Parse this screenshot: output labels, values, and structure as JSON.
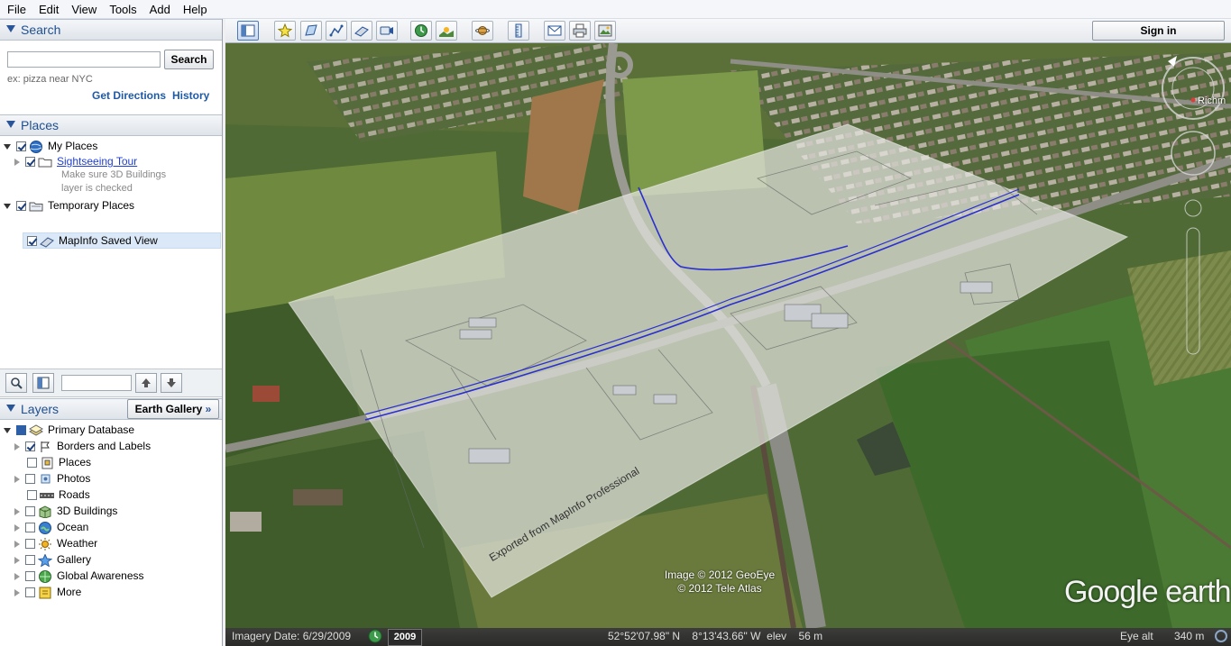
{
  "menu": [
    "File",
    "Edit",
    "View",
    "Tools",
    "Add",
    "Help"
  ],
  "search": {
    "title": "Search",
    "input_value": "",
    "button": "Search",
    "hint": "ex: pizza near NYC",
    "get_directions": "Get Directions",
    "history": "History"
  },
  "places": {
    "title": "Places",
    "my_places": "My Places",
    "sightseeing_tour": "Sightseeing Tour",
    "note_line1": "Make sure 3D Buildings",
    "note_line2": "layer is checked",
    "temporary_places": "Temporary Places",
    "saved_view": "MapInfo Saved View"
  },
  "layers": {
    "title": "Layers",
    "earth_gallery": "Earth Gallery",
    "items": [
      {
        "label": "Primary Database",
        "checked": true
      },
      {
        "label": "Borders and Labels",
        "checked": true
      },
      {
        "label": "Places",
        "checked": false
      },
      {
        "label": "Photos",
        "checked": false
      },
      {
        "label": "Roads",
        "checked": false
      },
      {
        "label": "3D Buildings",
        "checked": false
      },
      {
        "label": "Ocean",
        "checked": false
      },
      {
        "label": "Weather",
        "checked": false
      },
      {
        "label": "Gallery",
        "checked": false
      },
      {
        "label": "Global Awareness",
        "checked": false
      },
      {
        "label": "More",
        "checked": false
      }
    ]
  },
  "toolbar": {
    "sign_in": "Sign in",
    "icons": [
      "sidebar-toggle-icon",
      "placemark-icon",
      "polygon-icon",
      "path-icon",
      "image-overlay-icon",
      "tour-record-icon",
      "historical-imagery-icon",
      "sunlight-icon",
      "planets-icon",
      "ruler-icon",
      "email-icon",
      "print-icon",
      "save-image-icon"
    ]
  },
  "map": {
    "overlay_text": "Exported from MapInfo Professional",
    "compass_label": "Richm",
    "attribution_line1": "Image © 2012 GeoEye",
    "attribution_line2": "© 2012 Tele Atlas",
    "logo_google": "Google",
    "logo_earth": "earth"
  },
  "status": {
    "imagery_date": "Imagery Date: 6/29/2009",
    "year": "2009",
    "coordinates": "52°52'07.98\" N    8°13'43.66\" W  elev    56 m",
    "eye_alt_label": "Eye alt",
    "eye_alt_value": "340 m"
  },
  "colors": {
    "accent": "#1f4f8f",
    "link": "#1f5aa6",
    "route_line": "#2b2fd1"
  }
}
